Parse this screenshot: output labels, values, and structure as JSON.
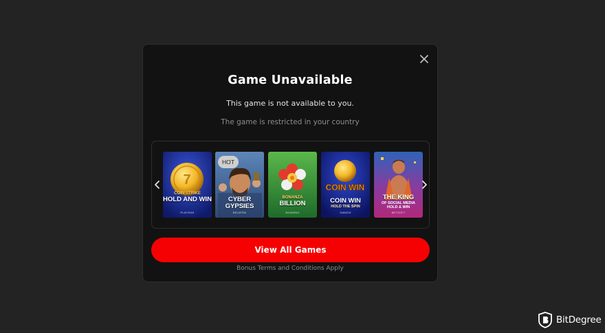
{
  "modal": {
    "title": "Game Unavailable",
    "subtitle": "This game is not available to you.",
    "restriction": "The game is restricted in your country",
    "cta_label": "View All Games",
    "terms": "Bonus Terms and Conditions Apply",
    "close_icon": "close-icon"
  },
  "carousel": {
    "prev_icon": "chevron-left-icon",
    "next_icon": "chevron-right-icon",
    "games": [
      {
        "kicker": "COIN STRIKE",
        "title": "HOLD AND WIN",
        "provider": "PLAYSON",
        "selected": false
      },
      {
        "badge": "HOT",
        "title": "CYBER GYPSIES",
        "provider": "BELATRA",
        "selected": true
      },
      {
        "kicker": "BONANZA",
        "title": "BILLION",
        "provider": "BGAMING",
        "selected": false
      },
      {
        "logo": "COIN WIN",
        "title": "COIN WIN",
        "subtitle": "HOLD THE SPIN",
        "provider": "GAMZIX",
        "selected": false
      },
      {
        "title": "THE KING",
        "subtitle": "OF SOCIAL MEDIA HOLD & WIN",
        "provider": "BETSOFT",
        "selected": false
      }
    ]
  },
  "watermark": {
    "brand": "BitDegree",
    "icon": "bitdegree-shield-logo"
  },
  "colors": {
    "background": "#232323",
    "modal_bg": "#121212",
    "accent": "#f50103"
  }
}
